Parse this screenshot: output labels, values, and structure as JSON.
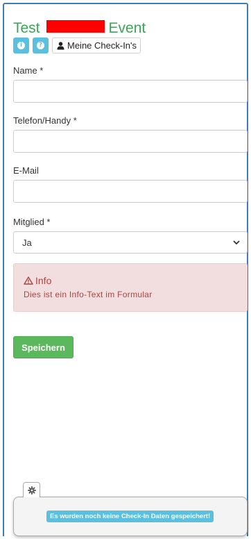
{
  "header": {
    "title_prefix": "Test",
    "title_suffix": "Event",
    "my_checkins_label": "Meine Check-In's",
    "info_button_icon": "info-icon",
    "help_button_icon": "question-icon",
    "user_icon": "user-icon",
    "title_color": "#3aa556",
    "redaction_color": "#ff0000"
  },
  "form": {
    "name_label": "Name *",
    "name_value": "",
    "phone_label": "Telefon/Handy *",
    "phone_value": "",
    "email_label": "E-Mail",
    "email_value": "",
    "member_label": "Mitglied *",
    "member_selected": "Ja",
    "member_dropdown_icon": "chevron-down-icon"
  },
  "info": {
    "title": "Info",
    "text": "Dies ist ein Info-Text im Formular",
    "icon": "warning-icon",
    "color": "#a94442",
    "background": "#f2dede"
  },
  "actions": {
    "save_label": "Speichern",
    "save_color": "#5cb85c"
  },
  "footer_panel": {
    "settings_icon": "gear-icon",
    "status_text": "Es wurden noch keine Check-In Daten gespeichert!",
    "status_color": "#5bc0de"
  }
}
